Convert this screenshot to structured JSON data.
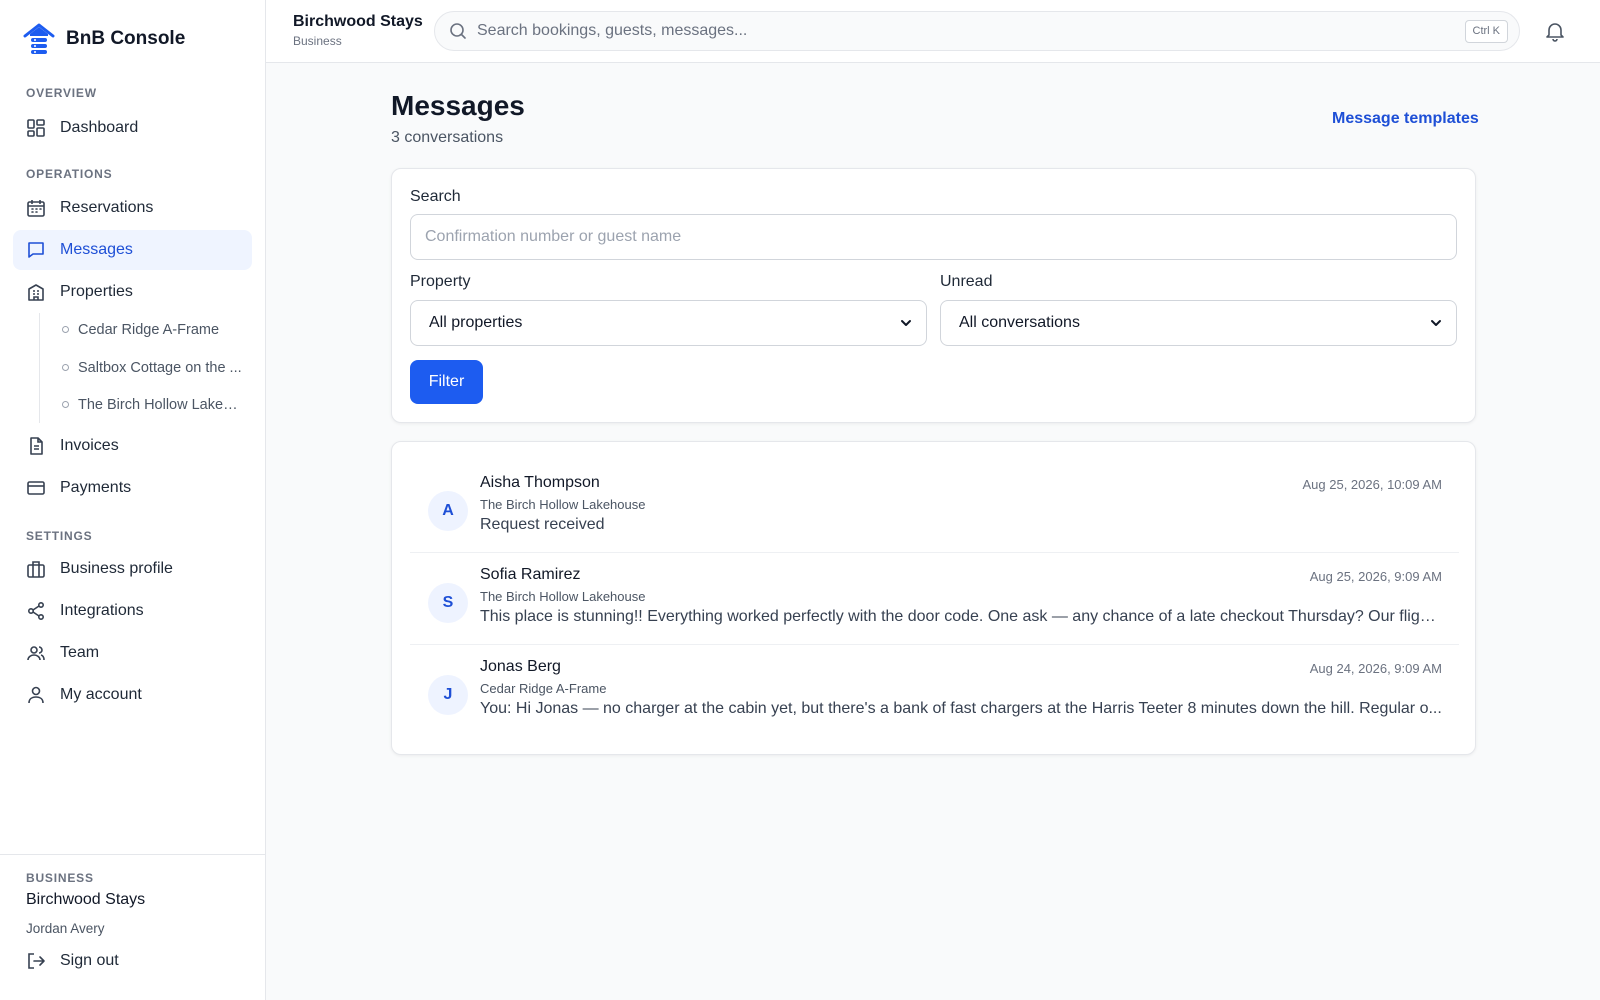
{
  "brand": {
    "name": "BnB Console"
  },
  "sidebar": {
    "sections": {
      "overview": "OVERVIEW",
      "operations": "OPERATIONS",
      "settings": "SETTINGS"
    },
    "items": {
      "dashboard": "Dashboard",
      "reservations": "Reservations",
      "messages": "Messages",
      "properties": "Properties",
      "invoices": "Invoices",
      "payments": "Payments",
      "business_profile": "Business profile",
      "integrations": "Integrations",
      "team": "Team",
      "my_account": "My account"
    },
    "properties": [
      "Cedar Ridge A-Frame",
      "Saltbox Cottage on the ...",
      "The Birch Hollow Lakeh..."
    ],
    "active": "messages",
    "footer": {
      "label": "BUSINESS",
      "business": "Birchwood Stays",
      "user": "Jordan Avery",
      "sign_out": "Sign out"
    }
  },
  "topbar": {
    "business": "Birchwood Stays",
    "plan": "Business",
    "search_placeholder": "Search bookings, guests, messages...",
    "shortcut": "Ctrl K"
  },
  "page": {
    "title": "Messages",
    "subtitle": "3 conversations",
    "templates_link": "Message templates"
  },
  "filters": {
    "search_label": "Search",
    "search_placeholder": "Confirmation number or guest name",
    "property_label": "Property",
    "property_value": "All properties",
    "unread_label": "Unread",
    "unread_value": "All conversations",
    "filter_button": "Filter"
  },
  "conversations": [
    {
      "initial": "A",
      "name": "Aisha Thompson",
      "property": "The Birch Hollow Lakehouse",
      "preview": "Request received",
      "time": "Aug 25, 2026, 10:09 AM"
    },
    {
      "initial": "S",
      "name": "Sofia Ramirez",
      "property": "The Birch Hollow Lakehouse",
      "preview": "This place is stunning!! Everything worked perfectly with the door code. One ask — any chance of a late checkout Thursday? Our flight...",
      "time": "Aug 25, 2026, 9:09 AM"
    },
    {
      "initial": "J",
      "name": "Jonas Berg",
      "property": "Cedar Ridge A-Frame",
      "preview": "You: Hi Jonas — no charger at the cabin yet, but there's a bank of fast chargers at the Harris Teeter 8 minutes down the hill. Regular o...",
      "time": "Aug 24, 2026, 9:09 AM"
    }
  ],
  "colors": {
    "accent": "#1d5cf0",
    "accent_text": "#1e4fd6",
    "active_bg": "#eff4ff"
  }
}
